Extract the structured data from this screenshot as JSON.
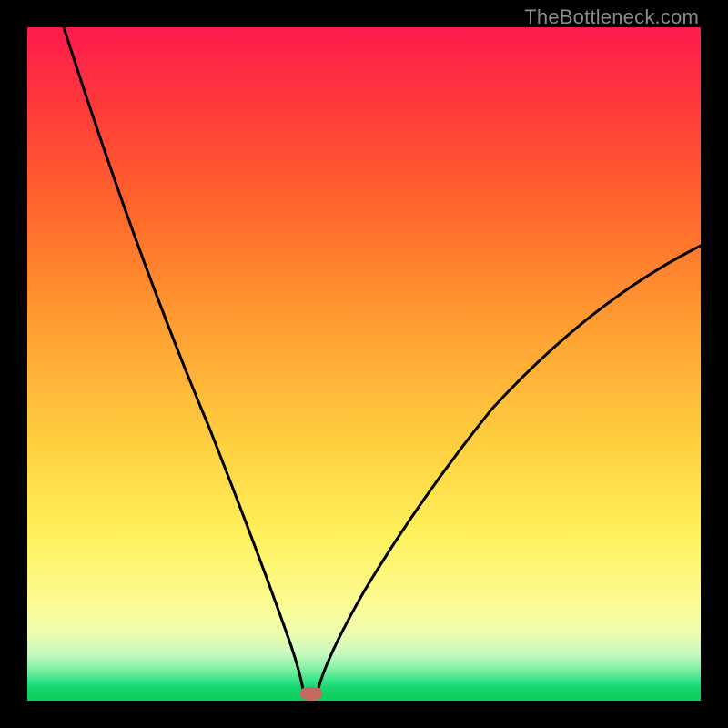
{
  "watermark": "TheBottleneck.com",
  "colors": {
    "top": "#ff1a4d",
    "mid": "#ffd040",
    "bottom": "#0acc5a",
    "curve": "#000000",
    "marker": "#c56a5e",
    "frame": "#000000"
  },
  "chart_data": {
    "type": "line",
    "title": "",
    "xlabel": "",
    "ylabel": "",
    "xlim": [
      0,
      100
    ],
    "ylim": [
      0,
      100
    ],
    "series": [
      {
        "name": "bottleneck-curve",
        "x": [
          0,
          5,
          10,
          15,
          20,
          25,
          30,
          35,
          38,
          40,
          41.5,
          43,
          45,
          50,
          55,
          60,
          65,
          70,
          75,
          80,
          85,
          90,
          95,
          100
        ],
        "values": [
          100,
          88,
          76,
          65,
          54,
          43,
          32,
          20,
          10,
          3,
          0,
          0,
          2,
          8,
          15,
          22,
          29,
          36,
          43,
          49,
          55,
          60,
          64,
          68
        ]
      }
    ],
    "annotations": [
      {
        "name": "optimal-marker",
        "x": 41.5,
        "y": 0
      }
    ]
  }
}
